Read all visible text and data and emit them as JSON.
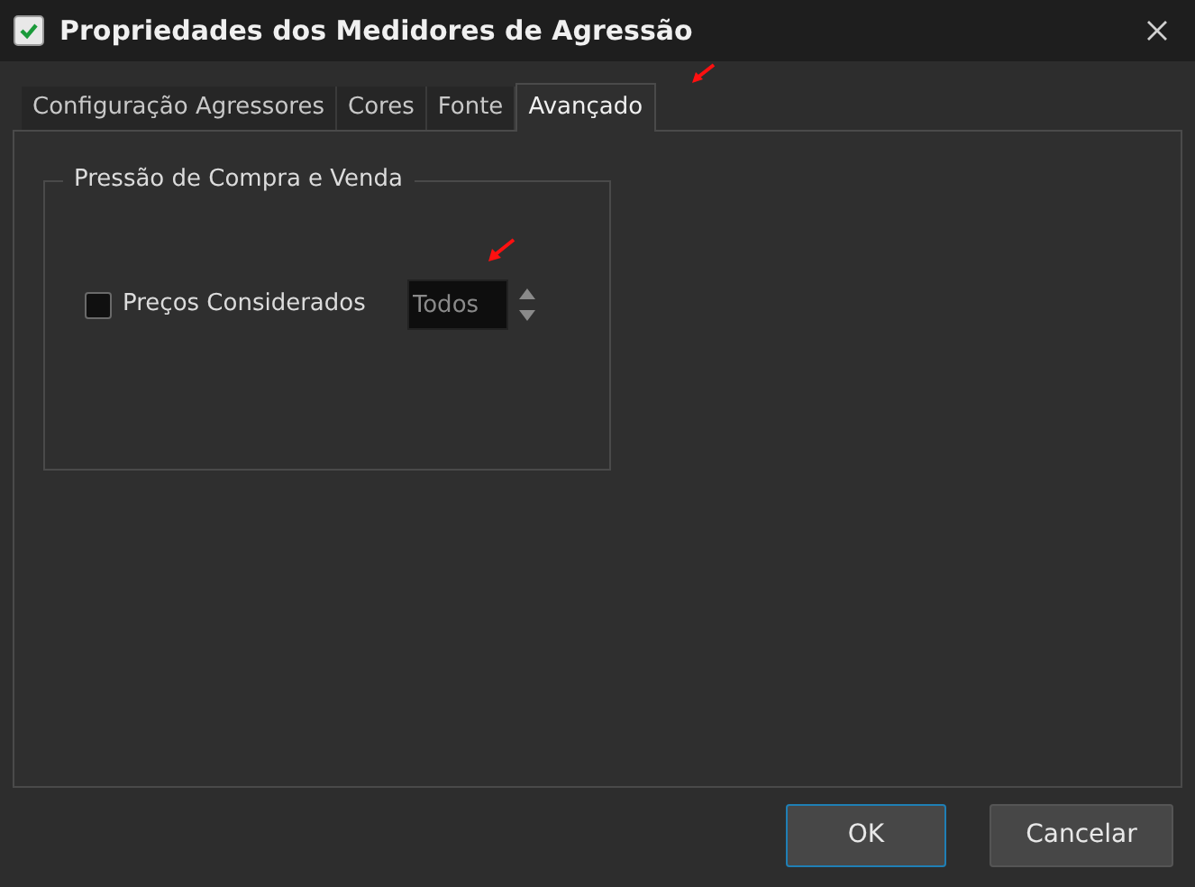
{
  "window": {
    "title": "Propriedades dos Medidores de Agressão"
  },
  "tabs": [
    {
      "label": "Configuração Agressores",
      "selected": false
    },
    {
      "label": "Cores",
      "selected": false
    },
    {
      "label": "Fonte",
      "selected": false
    },
    {
      "label": "Avançado",
      "selected": true
    }
  ],
  "group": {
    "title": "Pressão de Compra e Venda",
    "checkbox": {
      "label": "Preços Considerados",
      "checked": false
    },
    "spin": {
      "value": "Todos",
      "disabled": true
    }
  },
  "buttons": [
    {
      "label": "OK",
      "default": true
    },
    {
      "label": "Cancelar",
      "default": false
    }
  ]
}
